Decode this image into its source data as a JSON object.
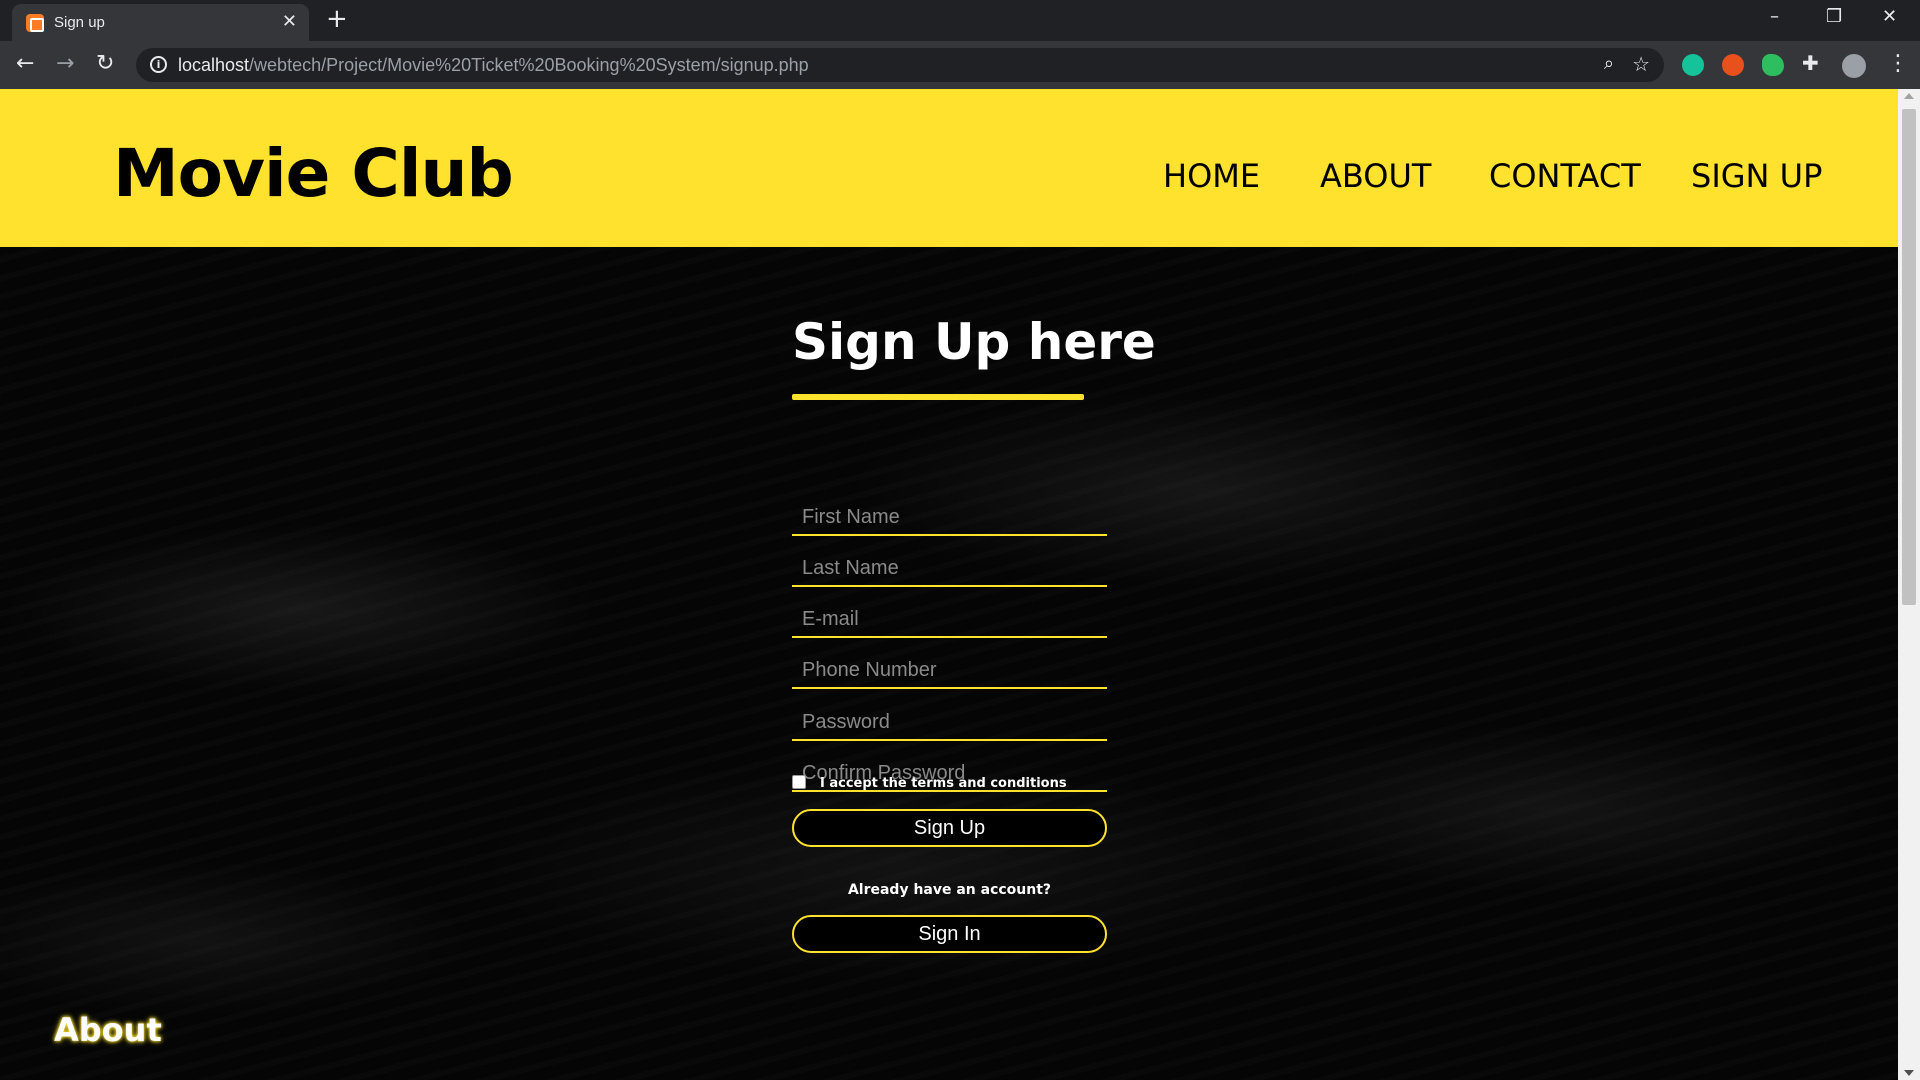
{
  "browser": {
    "tab_title": "Sign up",
    "tab_close": "✕",
    "new_tab": "+",
    "url_host": "localhost",
    "url_path": "/webtech/Project/Movie%20Ticket%20Booking%20System/signup.php",
    "window_controls": {
      "minimize": "–",
      "restore": "❐",
      "close": "✕"
    },
    "nav": {
      "back": "←",
      "forward": "→",
      "reload": "↻"
    },
    "info_icon": "i",
    "zoom_icon": "⌕",
    "star_icon": "☆",
    "menu_icon": "⋮",
    "extensions": [
      {
        "name": "grammarly-icon",
        "color": "#15c39a"
      },
      {
        "name": "fox-extension-icon",
        "color": "#e8501c"
      },
      {
        "name": "evernote-icon",
        "color": "#2dbe60"
      },
      {
        "name": "puzzle-extensions-icon",
        "color": "#e8eaed"
      },
      {
        "name": "profile-avatar",
        "color": "#9aa0a6"
      }
    ]
  },
  "header": {
    "brand": "Movie Club",
    "nav": [
      "HOME",
      "ABOUT",
      "CONTACT",
      "SIGN UP"
    ],
    "background": "#ffe22e"
  },
  "form": {
    "title": "Sign Up here",
    "fields": {
      "first_name": "First Name",
      "last_name": "Last Name",
      "email": "E-mail",
      "phone": "Phone Number",
      "password": "Password",
      "confirm_password": "Confirm Password"
    },
    "terms_label": "I accept the terms and conditions",
    "signup_button": "Sign Up",
    "already_text": "Already have an account?",
    "signin_button": "Sign In"
  },
  "footer": {
    "about_heading": "About"
  }
}
